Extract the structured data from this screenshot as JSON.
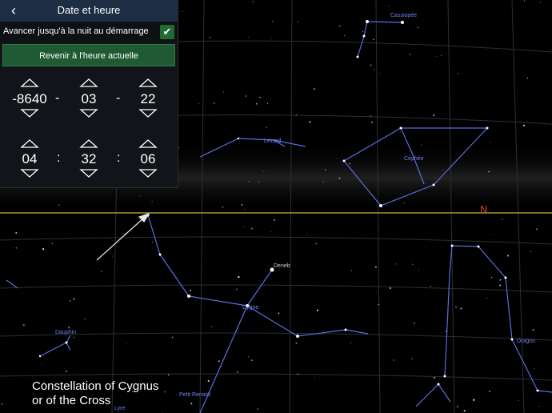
{
  "panel": {
    "title": "Date et heure",
    "back_icon": "chevron-left-icon",
    "night_option_label": "Avancer jusqu'à la nuit au démarrage",
    "night_option_checked": true,
    "reset_label": "Revenir à l'heure actuelle",
    "date": {
      "year": "-8640",
      "month": "03",
      "day": "22",
      "sep1": "-",
      "sep2": "-"
    },
    "time": {
      "hour": "04",
      "minute": "32",
      "second": "06",
      "sep1": ":",
      "sep2": ":"
    }
  },
  "sky": {
    "labels": {
      "cassiopeia": "Cassiopée",
      "lezard": "Lézard",
      "cephee": "Céphée",
      "deneb": "Deneb",
      "cygne": "Cygne",
      "dauphin": "Dauphin",
      "dragon": "Dragon",
      "petit_renard": "Petit Renard",
      "lyre": "Lyre"
    },
    "horizon_direction": "N",
    "caption_line1": "Constellation of Cygnus",
    "caption_line2": "or of the Cross",
    "colors": {
      "horizon": "#c9b23a",
      "constellation": "#5a6ee0",
      "grid": "#2b2f3a",
      "north": "#e3412c"
    }
  }
}
